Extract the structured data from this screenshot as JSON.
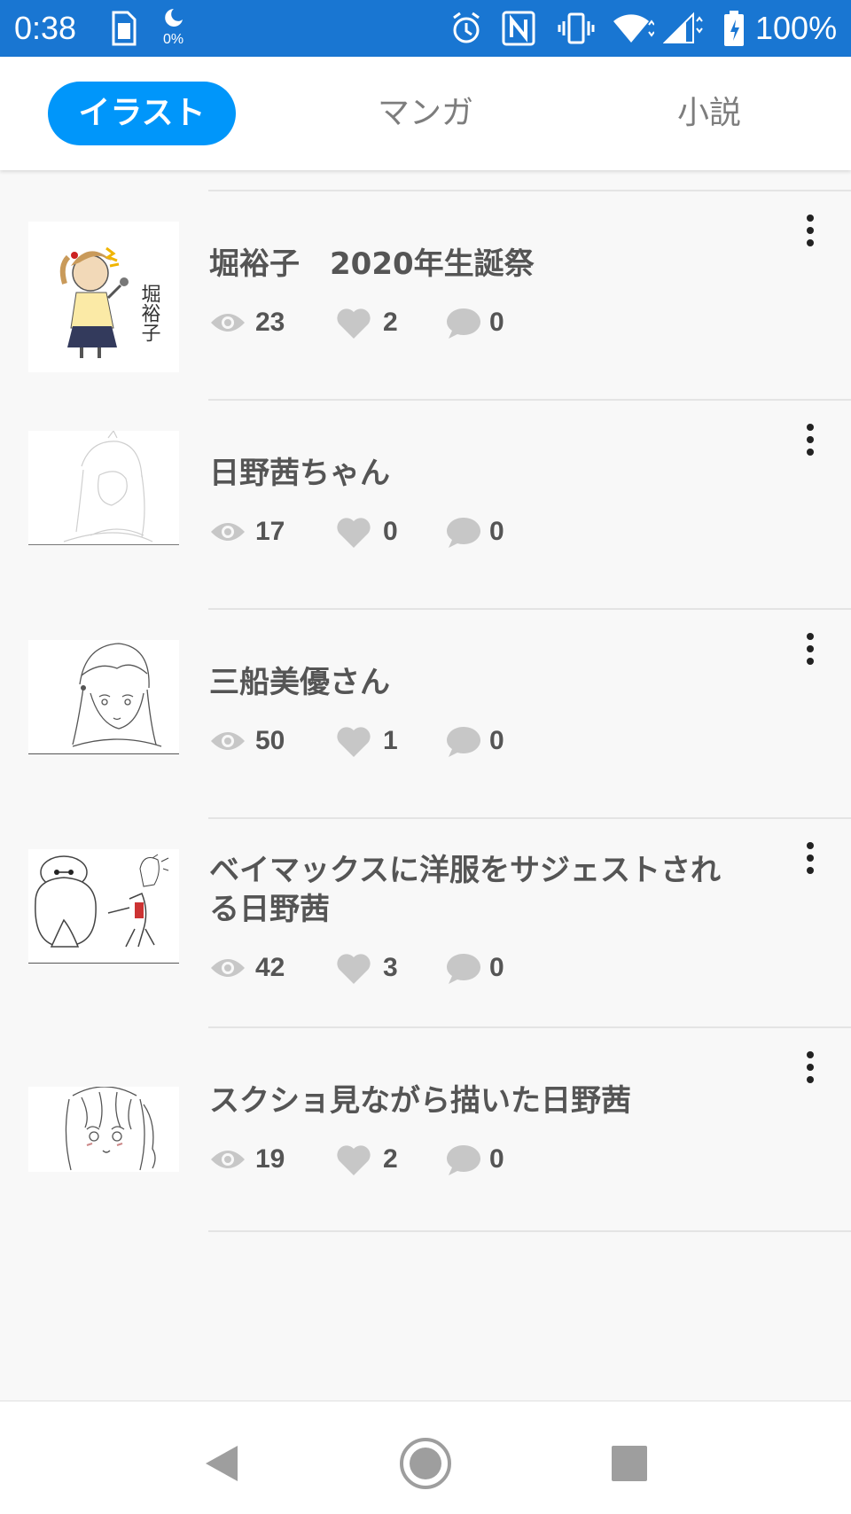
{
  "status_bar": {
    "time": "0:38",
    "data_usage": "0%",
    "battery": "100%",
    "icons": [
      "sim-icon",
      "data-saver-icon",
      "alarm-icon",
      "nfc-icon",
      "vibrate-icon",
      "wifi-icon",
      "signal-icon",
      "battery-icon"
    ]
  },
  "tabs": [
    {
      "label": "イラスト",
      "active": true
    },
    {
      "label": "マンガ",
      "active": false
    },
    {
      "label": "小説",
      "active": false
    }
  ],
  "works": [
    {
      "title": "堀裕子　2020年生誕祭",
      "views": "23",
      "likes": "2",
      "comments": "0"
    },
    {
      "title": "日野茜ちゃん",
      "views": "17",
      "likes": "0",
      "comments": "0"
    },
    {
      "title": "三船美優さん",
      "views": "50",
      "likes": "1",
      "comments": "0"
    },
    {
      "title_line1": "ベイマックスに洋服をサジェストされ",
      "title_line2": "る日野茜",
      "views": "42",
      "likes": "3",
      "comments": "0"
    },
    {
      "title": "スクショ見ながら描いた日野茜",
      "views": "19",
      "likes": "2",
      "comments": "0"
    }
  ],
  "thumb_text": {
    "name_vertical": "堀裕子"
  },
  "nav": {
    "icons": [
      "back-icon",
      "home-icon",
      "recents-icon"
    ]
  },
  "colors": {
    "status_bar": "#1976d2",
    "tab_active": "#0096fa"
  }
}
